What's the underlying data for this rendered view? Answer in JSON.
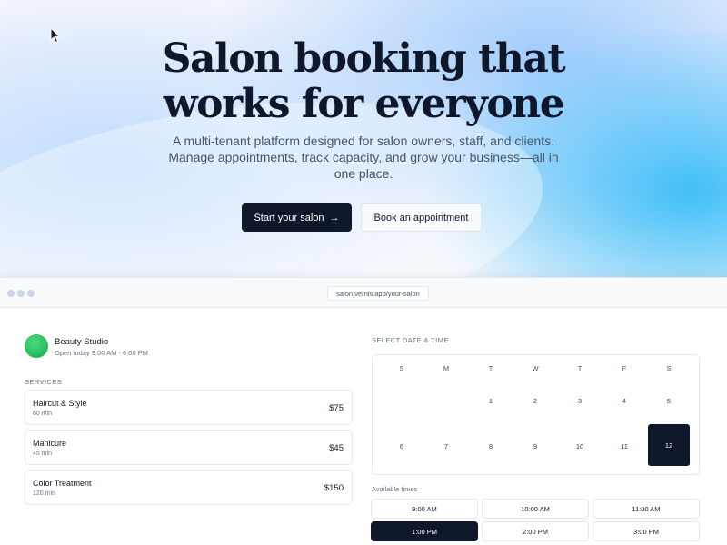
{
  "hero": {
    "title_line1": "Salon booking that",
    "title_line2": "works for everyone",
    "subtitle": "A multi-tenant platform designed for salon owners, staff, and clients. Manage appointments, track capacity, and grow your business—all in one place.",
    "primary_cta": "Start your salon",
    "primary_cta_icon": "→",
    "secondary_cta": "Book an appointment"
  },
  "browser": {
    "url": "salon.vernis.app/your-salon"
  },
  "studio": {
    "name": "Beauty Studio",
    "hours": "Open today 9:00 AM - 6:00 PM"
  },
  "services": {
    "label": "SERVICES",
    "items": [
      {
        "name": "Haircut & Style",
        "duration": "60 min",
        "price": "$75"
      },
      {
        "name": "Manicure",
        "duration": "45 min",
        "price": "$45"
      },
      {
        "name": "Color Treatment",
        "duration": "120 min",
        "price": "$150"
      }
    ]
  },
  "calendar": {
    "label": "SELECT DATE & TIME",
    "weekdays": [
      "S",
      "M",
      "T",
      "W",
      "T",
      "F",
      "S"
    ],
    "row1": [
      "",
      "",
      "1",
      "2",
      "3",
      "4",
      "5"
    ],
    "row2": [
      "6",
      "7",
      "8",
      "9",
      "10",
      "11",
      "12"
    ],
    "selected_day": "12"
  },
  "times": {
    "label": "Available times",
    "slots": [
      "9:00 AM",
      "10:00 AM",
      "11:00 AM",
      "1:00 PM",
      "2:00 PM",
      "3:00 PM"
    ],
    "selected": "1:00 PM"
  },
  "colors": {
    "primary": "#0f172a",
    "accent_blue": "#38bdf8",
    "studio_avatar": "#22c55e"
  }
}
